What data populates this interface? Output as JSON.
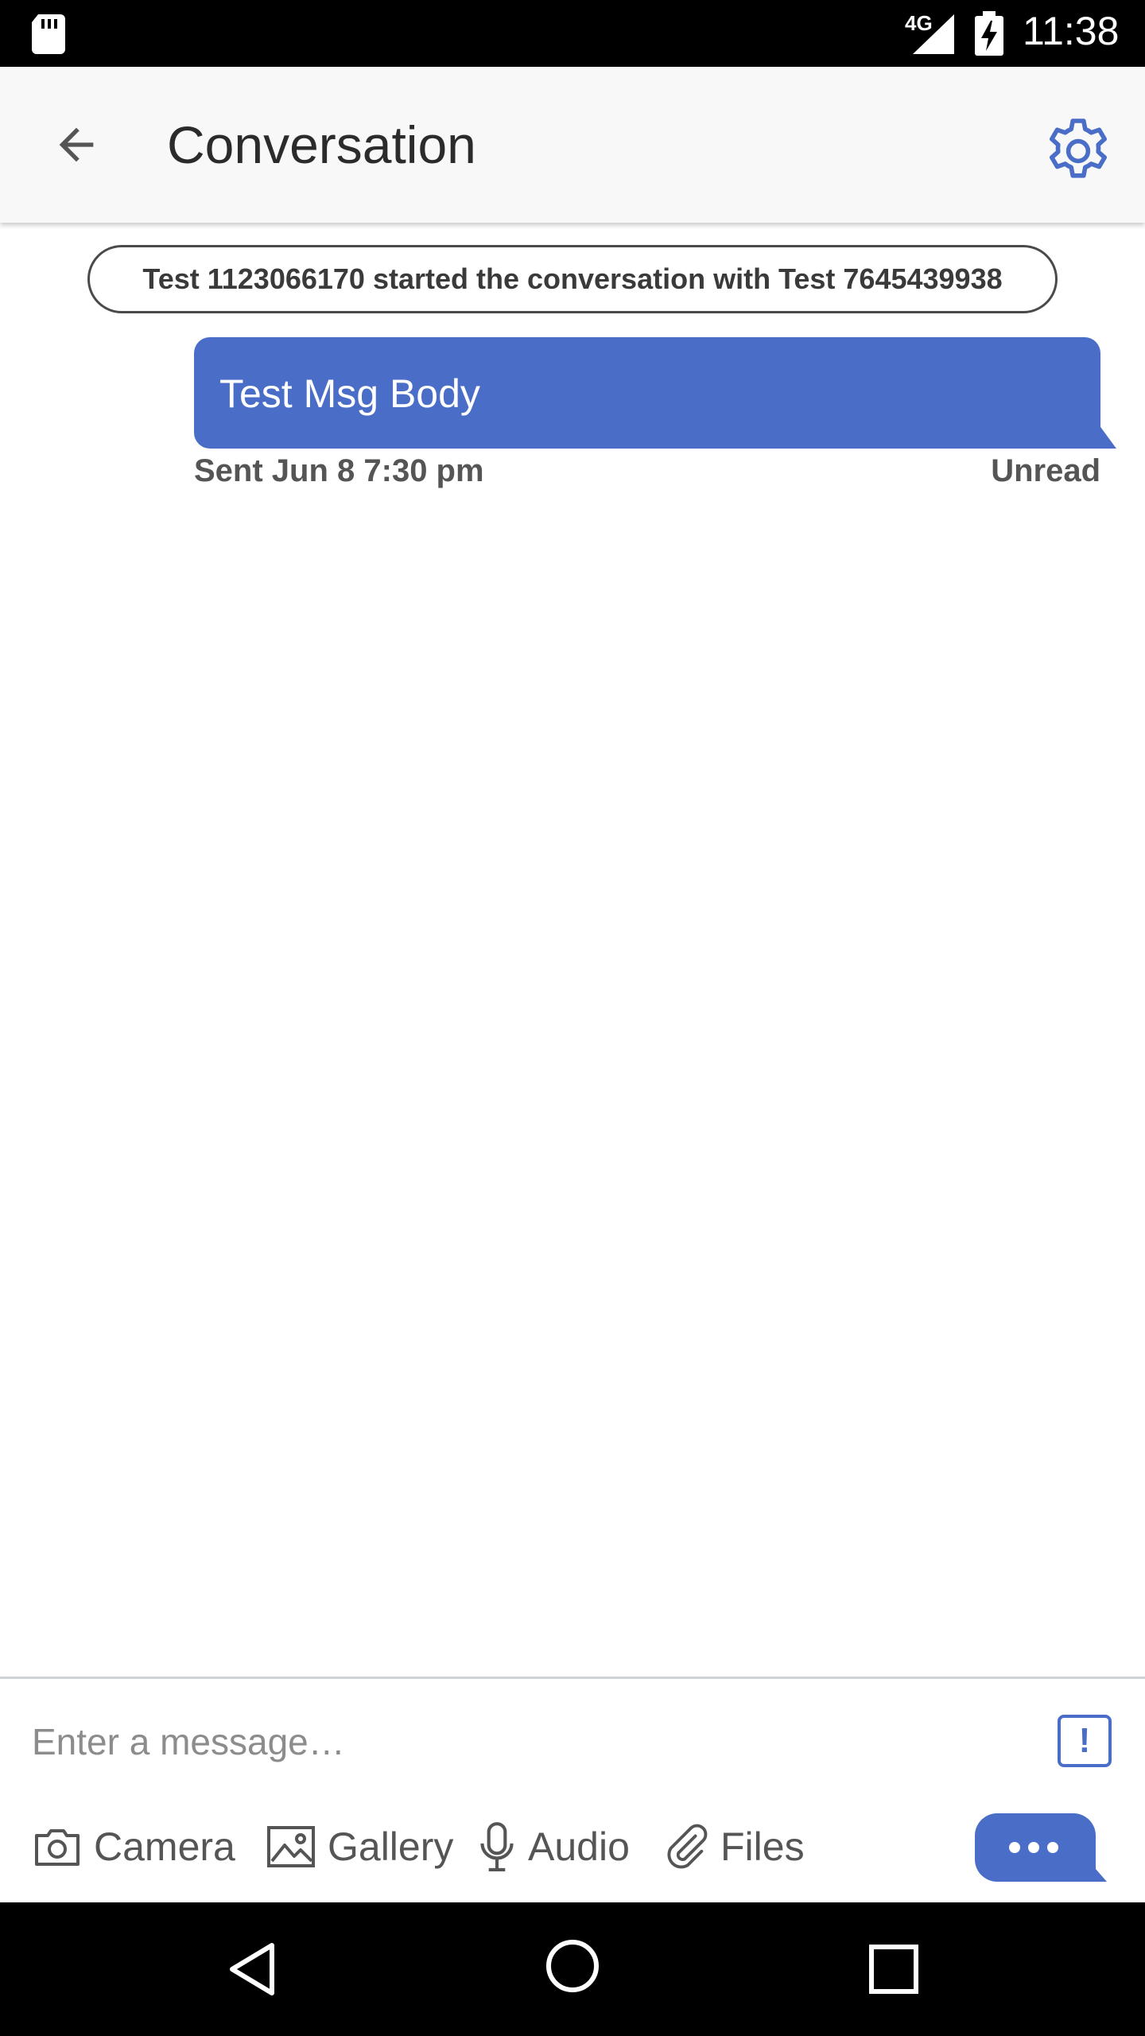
{
  "status_bar": {
    "network": "4G",
    "time": "11:38"
  },
  "app_bar": {
    "title": "Conversation",
    "back_icon": "arrow-back-icon",
    "settings_icon": "gear-icon"
  },
  "conversation": {
    "system_message": "Test 1123066170 started the conversation with Test 7645439938",
    "messages": [
      {
        "body": "Test Msg Body",
        "sent_label": "Sent Jun 8 7:30 pm",
        "status": "Unread"
      }
    ]
  },
  "composer": {
    "placeholder": "Enter a message…",
    "priority_symbol": "!",
    "attachments": [
      {
        "label": "Camera",
        "icon": "camera-icon"
      },
      {
        "label": "Gallery",
        "icon": "gallery-icon"
      },
      {
        "label": "Audio",
        "icon": "microphone-icon"
      },
      {
        "label": "Files",
        "icon": "paperclip-icon"
      }
    ],
    "send_icon": "more-dots-icon"
  },
  "colors": {
    "accent": "#4a6ec7",
    "status_bar": "#000000",
    "app_bar": "#f8f8f8"
  }
}
